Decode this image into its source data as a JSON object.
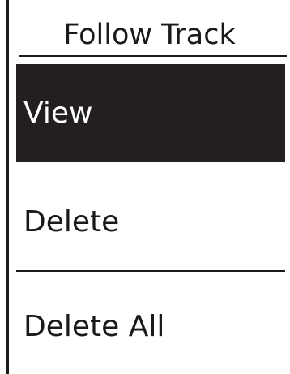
{
  "screen": {
    "title": "Follow Track"
  },
  "menu": {
    "items": [
      {
        "label": "View",
        "selected": true
      },
      {
        "label": "Delete",
        "selected": false
      },
      {
        "label": "Delete All",
        "selected": false
      }
    ]
  },
  "colors": {
    "selected_background": "#231f20",
    "selected_text": "#ffffff",
    "text": "#1a1a1a",
    "background": "#ffffff"
  }
}
